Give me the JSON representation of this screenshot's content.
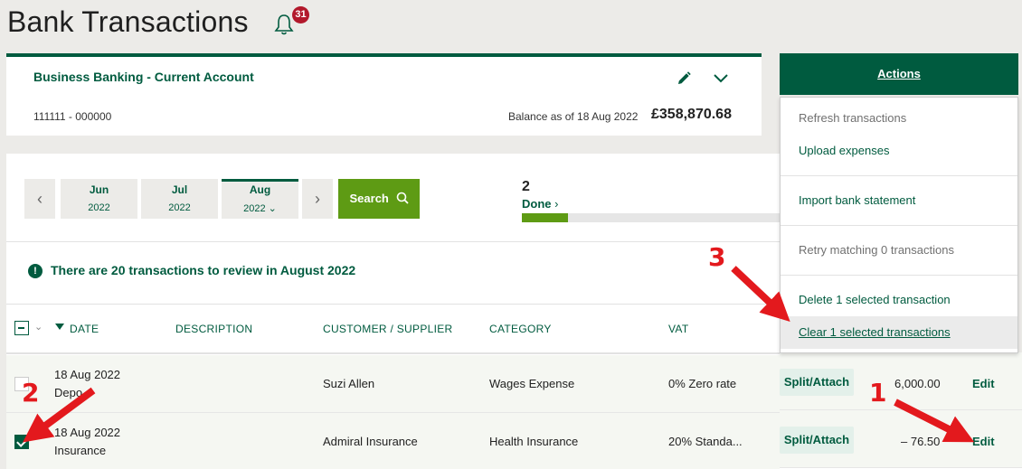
{
  "header": {
    "title": "Bank Transactions",
    "notification_count": "31"
  },
  "account": {
    "name": "Business Banking - Current Account",
    "number": "111111 - 000000",
    "balance_label": "Balance as of 18 Aug 2022",
    "balance_value": "£358,870.68"
  },
  "months": [
    {
      "month": "Jun",
      "year": "2022",
      "active": false
    },
    {
      "month": "Jul",
      "year": "2022",
      "active": false
    },
    {
      "month": "Aug",
      "year": "2022 ⌄",
      "active": true
    }
  ],
  "search": {
    "label": "Search"
  },
  "progress": {
    "count": "2",
    "label": "Done",
    "fraction": 0.18
  },
  "notice": {
    "text": "There are 20 transactions to review in August 2022"
  },
  "table": {
    "columns": [
      "DATE",
      "DESCRIPTION",
      "CUSTOMER / SUPPLIER",
      "CATEGORY",
      "VAT"
    ],
    "rows": [
      {
        "date": "18 Aug 2022",
        "desc": "Depo",
        "customer": "Suzi Allen",
        "category": "Wages Expense",
        "vat": "0% Zero rate",
        "split": "Split/Attach",
        "amount": "6,000.00",
        "edit": "Edit",
        "checked": false
      },
      {
        "date": "18 Aug 2022",
        "desc": "Insurance",
        "customer": "Admiral Insurance",
        "category": "Health Insurance",
        "vat": "20% Standa...",
        "split": "Split/Attach",
        "amount": "– 76.50",
        "edit": "Edit",
        "checked": true
      }
    ]
  },
  "actions": {
    "label": "Actions",
    "menu": [
      {
        "label": "Refresh transactions",
        "style": "grey"
      },
      {
        "label": "Upload expenses",
        "style": "green"
      },
      {
        "label": "Import bank statement",
        "style": "green"
      },
      {
        "label": "Retry matching 0 transactions",
        "style": "grey"
      },
      {
        "label": "Delete 1 selected transaction",
        "style": "green"
      },
      {
        "label": "Clear 1 selected transactions",
        "style": "hover"
      }
    ]
  },
  "annotations": {
    "one": "1",
    "two": "2",
    "three": "3",
    "color": "#e3191d"
  },
  "colors": {
    "brand": "#005b3f",
    "accent": "#5e9b14",
    "badge": "#b2182b"
  }
}
